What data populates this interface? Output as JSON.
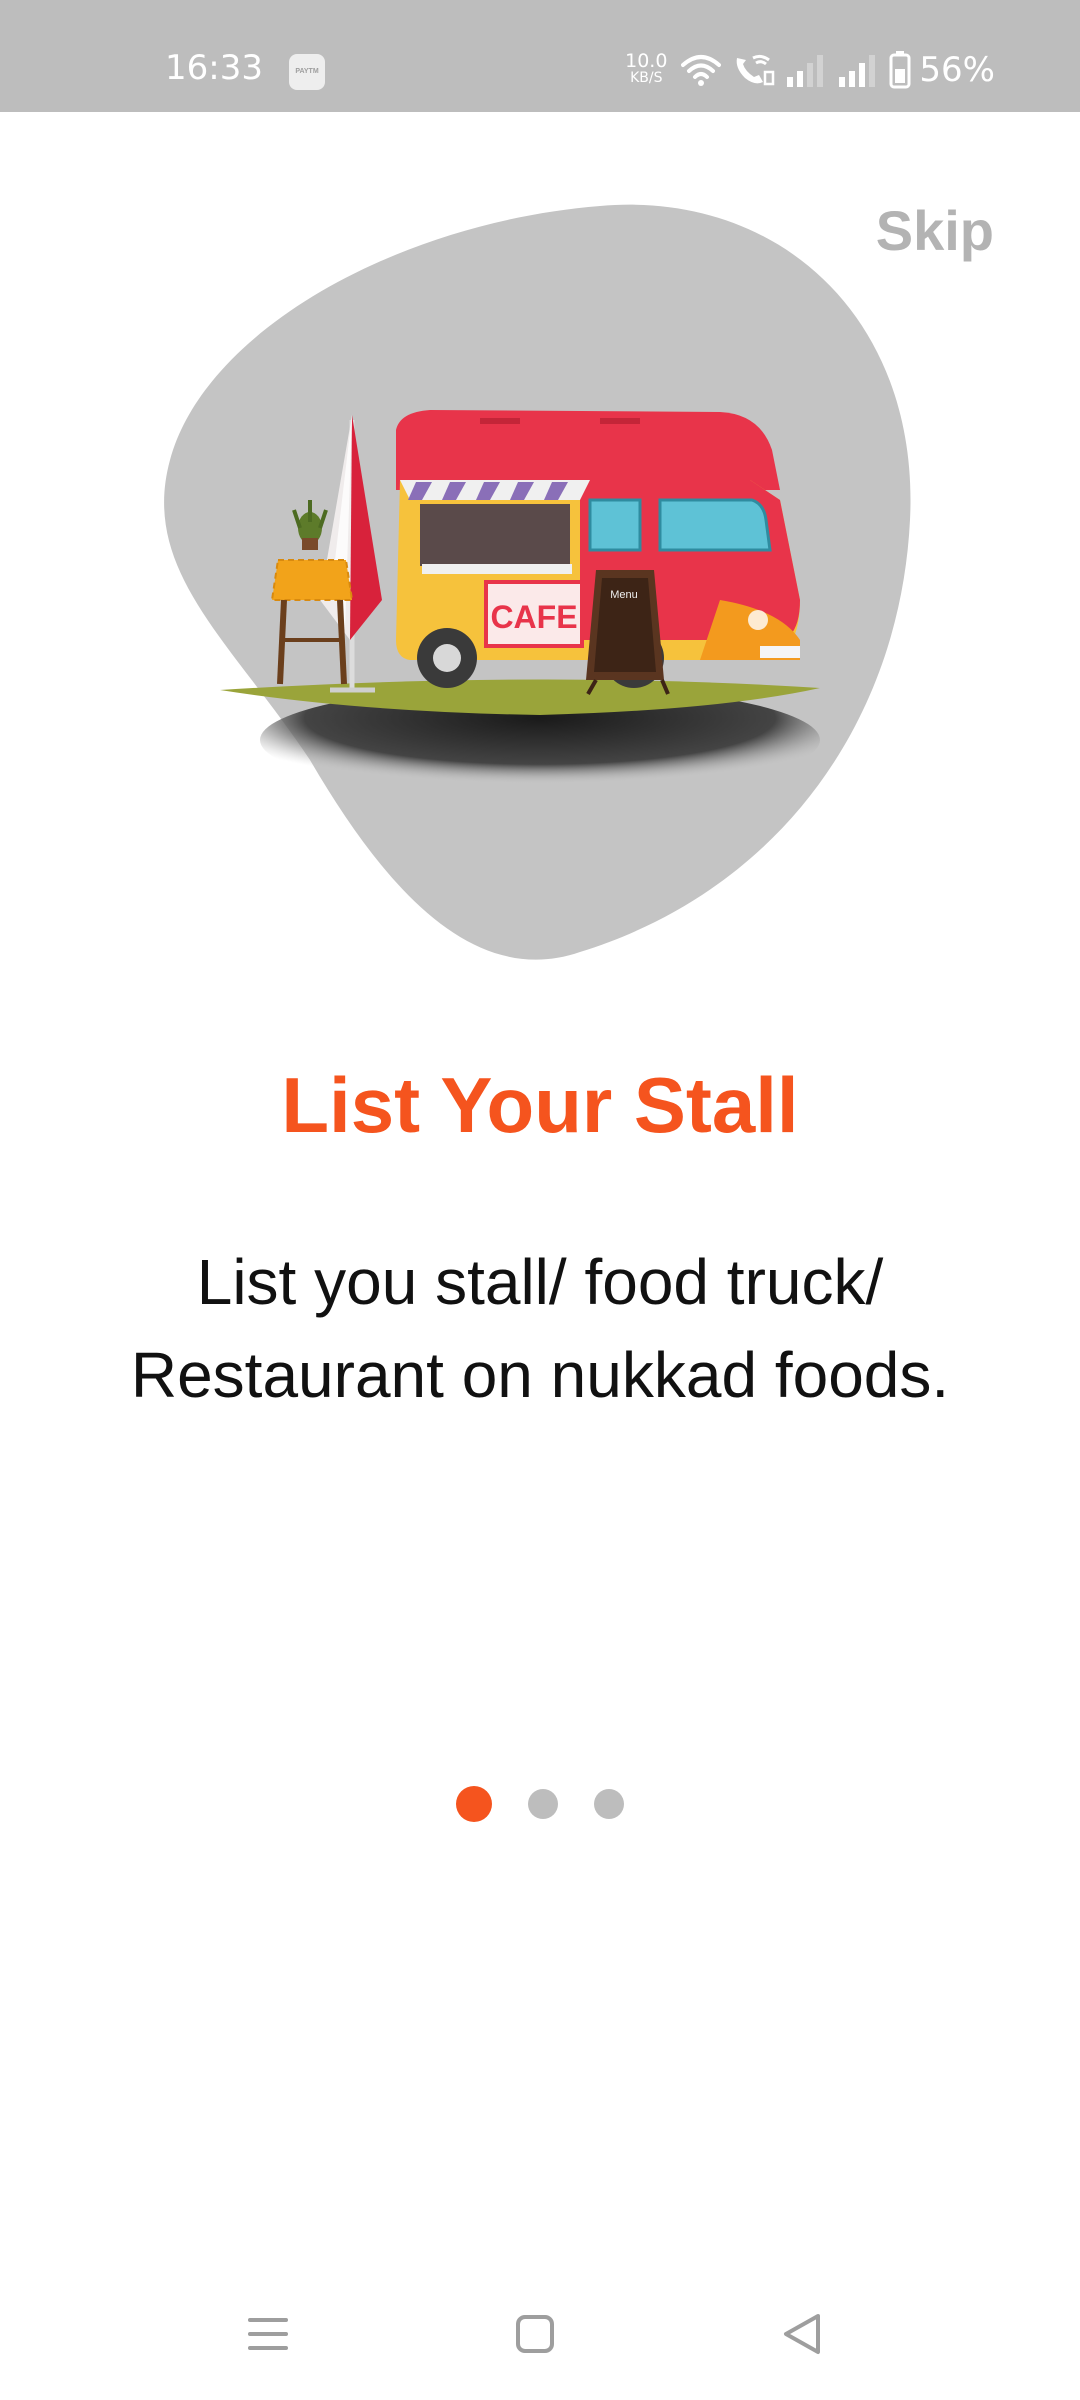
{
  "status_bar": {
    "time": "16:33",
    "app_icon_label": "PAYTM",
    "net_speed_value": "10.0",
    "net_speed_unit": "KB/S",
    "battery": "56%",
    "icons": [
      "wifi-icon",
      "wifi-call-icon",
      "signal-icon",
      "signal-icon",
      "battery-icon"
    ]
  },
  "onboarding": {
    "skip_label": "Skip",
    "title": "List Your Stall",
    "description": "List you stall/ food truck/ Restaurant on nukkad foods.",
    "page_count": 3,
    "current_page": 1,
    "illustration_sign_text": "CAFE",
    "illustration_board_text": "Menu"
  },
  "colors": {
    "accent": "#f5541e",
    "blob": "#c4c4c4",
    "inactive_dot": "#bdbdbd",
    "skip": "#b3b3b3"
  },
  "nav_bar": {
    "icons": [
      "menu-icon",
      "home-square-icon",
      "back-triangle-icon"
    ]
  }
}
